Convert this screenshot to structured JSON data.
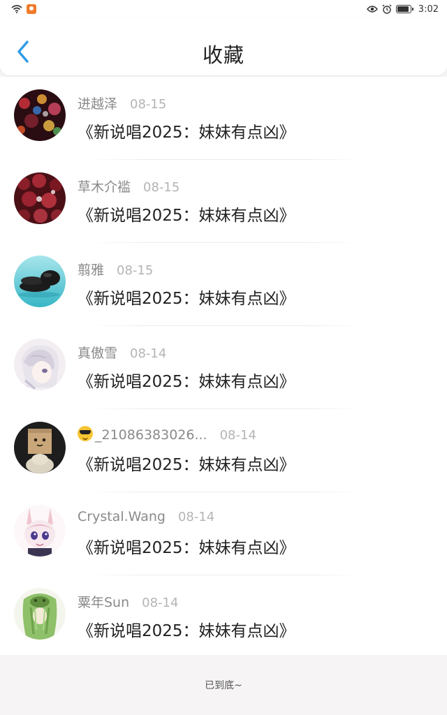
{
  "status_bar": {
    "time": "3:02",
    "icons": [
      "wifi-icon",
      "app-notification-icon",
      "eye-icon",
      "alarm-icon",
      "battery-icon"
    ]
  },
  "header": {
    "title": "收藏",
    "back_icon": "chevron-left-icon",
    "accent_color": "#2e9be6"
  },
  "items": [
    {
      "name": "进越泽",
      "date": "08-15",
      "title": "《新说唱2025：妹妹有点凶》",
      "avatar": "bokeh-lights"
    },
    {
      "name": "草木介褴",
      "date": "08-15",
      "title": "《新说唱2025：妹妹有点凶》",
      "avatar": "red-roses"
    },
    {
      "name": "翦雅",
      "date": "08-15",
      "title": "《新说唱2025：妹妹有点凶》",
      "avatar": "stones-on-water"
    },
    {
      "name": "真傲雪",
      "date": "08-14",
      "title": "《新说唱2025：妹妹有点凶》",
      "avatar": "anime-white-hair"
    },
    {
      "name": "_21086383026...",
      "date": "08-14",
      "title": "《新说唱2025：妹妹有点凶》",
      "avatar": "cardboard-box-face",
      "name_prefix_emoji": "sunglasses-emoji"
    },
    {
      "name": "Crystal.Wang",
      "date": "08-14",
      "title": "《新说唱2025：妹妹有点凶》",
      "avatar": "anime-bunny-girl"
    },
    {
      "name": "粟年Sun",
      "date": "08-14",
      "title": "《新说唱2025：妹妹有点凶》",
      "avatar": "green-hair-character"
    }
  ],
  "footer": {
    "end_text": "已到底~"
  }
}
